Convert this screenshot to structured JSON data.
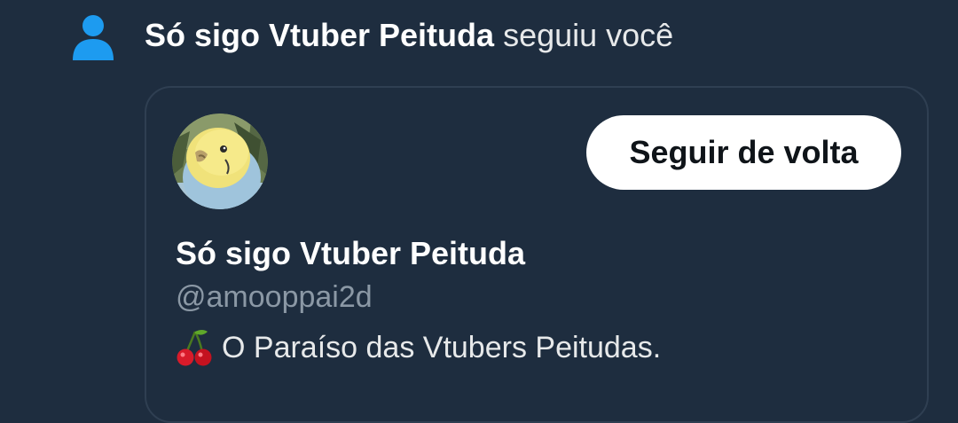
{
  "notification": {
    "icon": "person-icon",
    "follower_name": "Só sigo Vtuber Peituda",
    "action_text": " seguiu você"
  },
  "profile_card": {
    "avatar_icon": "budgie-avatar",
    "follow_back_label": "Seguir de volta",
    "display_name": "Só sigo Vtuber Peituda",
    "handle": "@amooppai2d",
    "bio_emoji": "cherry-icon",
    "bio_text": "O Paraíso das Vtubers Peitudas."
  },
  "colors": {
    "background": "#1e2d3f",
    "accent_blue": "#1d9bf0",
    "button_bg": "#ffffff",
    "button_text": "#0f1419",
    "muted_text": "#8b98a5",
    "card_border": "#2f3f52"
  }
}
